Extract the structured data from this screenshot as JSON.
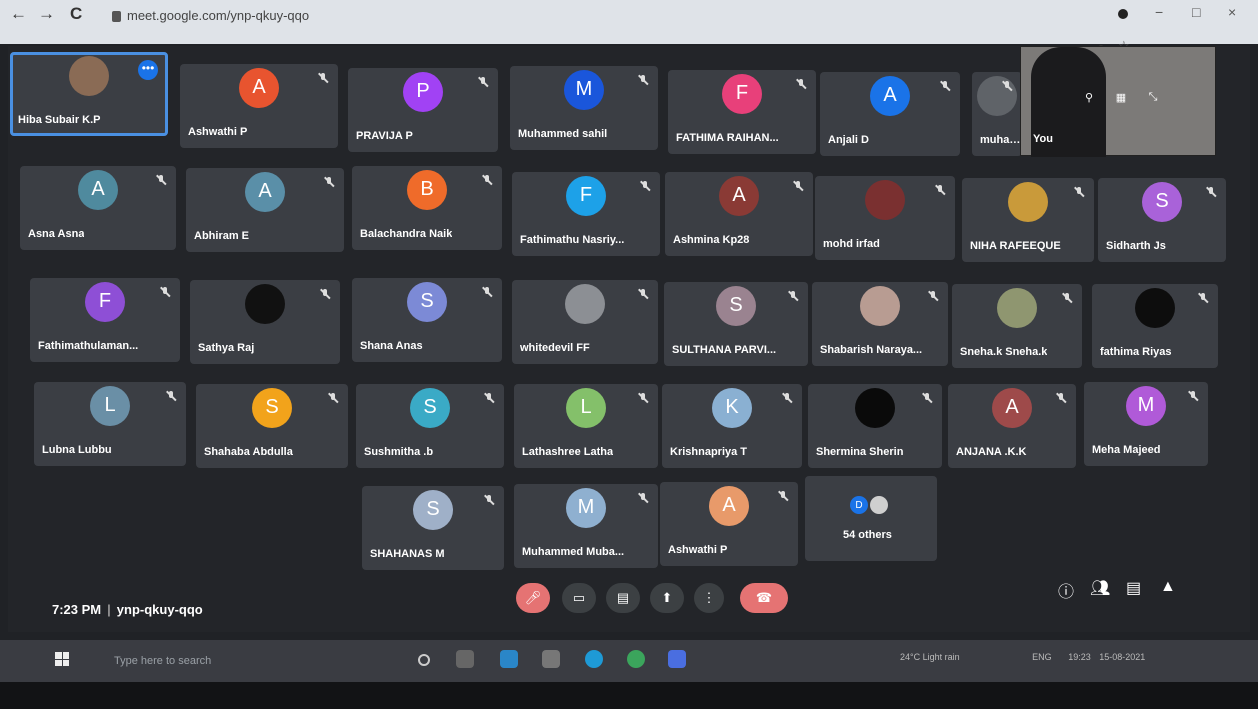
{
  "browser": {
    "url": "meet.google.com/ynp-qkuy-qqo",
    "back": "←",
    "forward": "→",
    "reload": "C",
    "win_min": "−",
    "win_max": "□",
    "win_close": "×"
  },
  "meeting": {
    "time": "7:23 PM",
    "code": "ynp-qkuy-qqo",
    "self_label": "You",
    "others_label": "54 others",
    "others_initial": "D"
  },
  "participants": [
    {
      "name": "Hiba Subair K.P",
      "initial": "",
      "color": "#8a6b55"
    },
    {
      "name": "Ashwathi P",
      "initial": "A",
      "color": "#e8542f"
    },
    {
      "name": "PRAVIJA P",
      "initial": "P",
      "color": "#a142f4"
    },
    {
      "name": "Muhammed sahil",
      "initial": "M",
      "color": "#1a56db"
    },
    {
      "name": "FATHIMA RAIHAN...",
      "initial": "F",
      "color": "#e8407a"
    },
    {
      "name": "Anjali D",
      "initial": "A",
      "color": "#1a73e8"
    },
    {
      "name": "muhamm",
      "initial": "",
      "color": "#5f6368"
    },
    {
      "name": "Asna Asna",
      "initial": "A",
      "color": "#4f8a9e"
    },
    {
      "name": "Abhiram E",
      "initial": "A",
      "color": "#5a8fa8"
    },
    {
      "name": "Balachandra Naik",
      "initial": "B",
      "color": "#ef6b2a"
    },
    {
      "name": "Fathimathu Nasriy...",
      "initial": "F",
      "color": "#1da1e8"
    },
    {
      "name": "Ashmina Kp28",
      "initial": "A",
      "color": "#8a3a35"
    },
    {
      "name": "mohd irfad",
      "initial": "",
      "color": "#7a3030"
    },
    {
      "name": "NIHA RAFEEQUE",
      "initial": "",
      "color": "#c99a3a"
    },
    {
      "name": "Sidharth Js",
      "initial": "S",
      "color": "#a962d9"
    },
    {
      "name": "Fathimathulaman...",
      "initial": "F",
      "color": "#8e4fd6"
    },
    {
      "name": "Sathya Raj",
      "initial": "",
      "color": "#111111"
    },
    {
      "name": "Shana Anas",
      "initial": "S",
      "color": "#7c8ad6"
    },
    {
      "name": "whitedevil FF",
      "initial": "",
      "color": "#8c8f94"
    },
    {
      "name": "SULTHANA PARVI...",
      "initial": "S",
      "color": "#9a8390"
    },
    {
      "name": "Shabarish Naraya...",
      "initial": "",
      "color": "#b89c92"
    },
    {
      "name": "Sneha.k Sneha.k",
      "initial": "",
      "color": "#8f9670"
    },
    {
      "name": "fathima Riyas",
      "initial": "",
      "color": "#0d0d0d"
    },
    {
      "name": "Lubna Lubbu",
      "initial": "L",
      "color": "#6a8fa6"
    },
    {
      "name": "Shahaba Abdulla",
      "initial": "S",
      "color": "#f2a31b"
    },
    {
      "name": "Sushmitha .b",
      "initial": "S",
      "color": "#3aaac6"
    },
    {
      "name": "Lathashree Latha",
      "initial": "L",
      "color": "#84c06a"
    },
    {
      "name": "Krishnapriya T",
      "initial": "K",
      "color": "#8ab0d2"
    },
    {
      "name": "Shermina Sherin",
      "initial": "",
      "color": "#0a0a0a"
    },
    {
      "name": "ANJANA .K.K",
      "initial": "A",
      "color": "#9e4a4a"
    },
    {
      "name": "Meha Majeed",
      "initial": "M",
      "color": "#b05ad8"
    },
    {
      "name": "SHAHANAS M",
      "initial": "S",
      "color": "#9fb0c8"
    },
    {
      "name": "Muhammed Muba...",
      "initial": "M",
      "color": "#8fb0d0"
    },
    {
      "name": "Ashwathi P",
      "initial": "A",
      "color": "#e89a6a"
    }
  ],
  "taskbar": {
    "search_placeholder": "Type here to search",
    "weather": "24°C  Light rain",
    "lang": "ENG",
    "clock": "19:23",
    "date": "15-08-2021"
  },
  "colors": {
    "accent": "#1a73e8",
    "end_call": "#e57373",
    "tile_bg": "#3b3e44"
  }
}
